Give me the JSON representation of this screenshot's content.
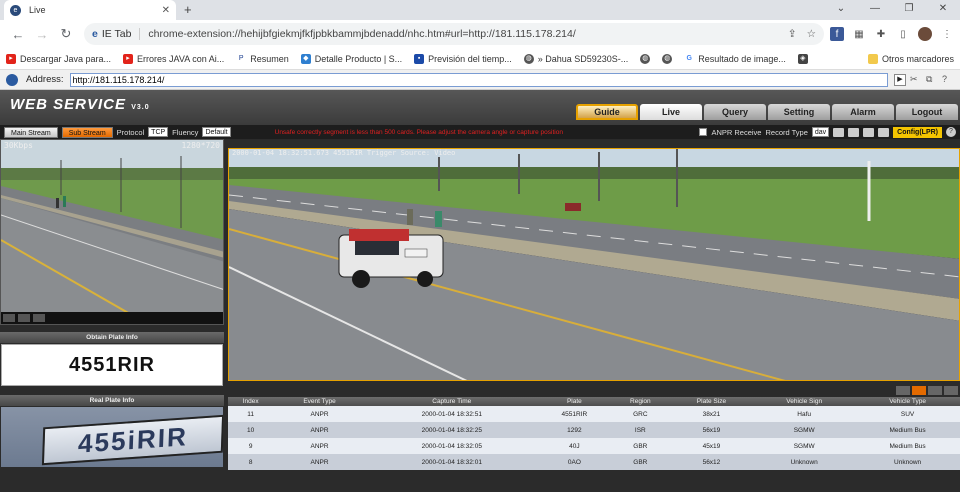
{
  "browser": {
    "tab_title": "Live",
    "omnibox_ext": "IE Tab",
    "omnibox_url": "chrome-extension://hehijbfgiekmjfkfjpbkbammjbdenadd/nhc.htm#url=http://181.115.178.214/",
    "bookmarks": [
      "Descargar Java para...",
      "Errores JAVA con Ai...",
      "Resumen",
      "Detalle Producto | S...",
      "Previsión del tiemp...",
      "» Dahua SD59230S-...",
      "Resultado de image..."
    ],
    "bookmarks_right": "Otros marcadores"
  },
  "ie_address": {
    "label": "Address:",
    "value": "http://181.115.178.214/"
  },
  "app": {
    "logo": "WEB  SERVICE",
    "logo_version": "V3.0",
    "nav": [
      "Guide",
      "Live",
      "Query",
      "Setting",
      "Alarm",
      "Logout"
    ]
  },
  "controls": {
    "main_stream": "Main Stream",
    "sub_stream": "Sub Stream",
    "protocol_label": "Protocol",
    "protocol_value": "TCP",
    "fluency_label": "Fluency",
    "fluency_value": "Default",
    "warning": "Unsafe correctly segment is less than 500 cards. Please adjust the camera angle or capture position",
    "anpr_label": "ANPR Receive",
    "record_label": "Record Type",
    "record_value": "dav",
    "config_label": "Config(LPR)"
  },
  "small_cam": {
    "bitrate": "30Kbps",
    "resolution": "1280*720"
  },
  "big_cam": {
    "overlay": "2000-01-04 18:32:51.673 4551RIR Trigger Source: Video"
  },
  "obtain_plate": {
    "title": "Obtain Plate Info",
    "plate": "4551RIR"
  },
  "real_plate": {
    "title": "Real Plate Info",
    "plate": "455iRIR"
  },
  "table": {
    "headers": [
      "Index",
      "Event Type",
      "Capture Time",
      "Plate",
      "Region",
      "Plate Size",
      "Vehicle Sign",
      "Vehicle Type"
    ],
    "rows": [
      [
        "11",
        "ANPR",
        "2000-01-04 18:32:51",
        "4551RIR",
        "GRC",
        "38x21",
        "Hafu",
        "SUV"
      ],
      [
        "10",
        "ANPR",
        "2000-01-04 18:32:25",
        "1292",
        "ISR",
        "56x19",
        "SGMW",
        "Medium Bus"
      ],
      [
        "9",
        "ANPR",
        "2000-01-04 18:32:05",
        "40J",
        "GBR",
        "45x19",
        "SGMW",
        "Medium Bus"
      ],
      [
        "8",
        "ANPR",
        "2000-01-04 18:32:01",
        "0AO",
        "GBR",
        "56x12",
        "Unknown",
        "Unknown"
      ]
    ]
  }
}
